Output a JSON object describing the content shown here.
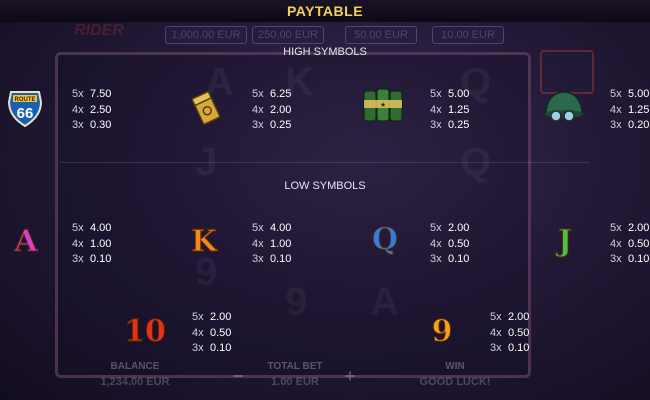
{
  "header": {
    "title": "PAYTABLE"
  },
  "sections": {
    "high_title": "HIGH SYMBOLS",
    "low_title": "LOW SYMBOLS"
  },
  "background": {
    "bets": [
      "1,000.00 EUR",
      "250.00 EUR",
      "50.00 EUR",
      "10.00 EUR"
    ],
    "logo": "RIDER",
    "balance_label": "BALANCE",
    "balance_value": "1,234.00 EUR",
    "bet_label": "TOTAL BET",
    "bet_value": "1.00 EUR",
    "win_label": "WIN",
    "win_value": "GOOD LUCK!",
    "minus": "−",
    "plus": "+"
  },
  "high_symbols": [
    {
      "icon": "route-66-sign-icon",
      "pays": [
        {
          "mult": "5x",
          "value": "7.50"
        },
        {
          "mult": "4x",
          "value": "2.50"
        },
        {
          "mult": "3x",
          "value": "0.30"
        }
      ]
    },
    {
      "icon": "lighter-icon",
      "pays": [
        {
          "mult": "5x",
          "value": "6.25"
        },
        {
          "mult": "4x",
          "value": "2.00"
        },
        {
          "mult": "3x",
          "value": "0.25"
        }
      ]
    },
    {
      "icon": "cans-icon",
      "pays": [
        {
          "mult": "5x",
          "value": "5.00"
        },
        {
          "mult": "4x",
          "value": "1.25"
        },
        {
          "mult": "3x",
          "value": "0.25"
        }
      ]
    },
    {
      "icon": "helmet-icon",
      "pays": [
        {
          "mult": "5x",
          "value": "5.00"
        },
        {
          "mult": "4x",
          "value": "1.25"
        },
        {
          "mult": "3x",
          "value": "0.20"
        }
      ]
    }
  ],
  "low_symbols": [
    {
      "label": "A",
      "color": "#d63fd0",
      "pays": [
        {
          "mult": "5x",
          "value": "4.00"
        },
        {
          "mult": "4x",
          "value": "1.00"
        },
        {
          "mult": "3x",
          "value": "0.10"
        }
      ]
    },
    {
      "label": "K",
      "color": "#f08a1e",
      "pays": [
        {
          "mult": "5x",
          "value": "4.00"
        },
        {
          "mult": "4x",
          "value": "1.00"
        },
        {
          "mult": "3x",
          "value": "0.10"
        }
      ]
    },
    {
      "label": "Q",
      "color": "#2f7fe0",
      "pays": [
        {
          "mult": "5x",
          "value": "2.00"
        },
        {
          "mult": "4x",
          "value": "0.50"
        },
        {
          "mult": "3x",
          "value": "0.10"
        }
      ]
    },
    {
      "label": "J",
      "color": "#49c24a",
      "pays": [
        {
          "mult": "5x",
          "value": "2.00"
        },
        {
          "mult": "4x",
          "value": "0.50"
        },
        {
          "mult": "3x",
          "value": "0.10"
        }
      ]
    },
    {
      "label": "10",
      "color": "#e8301f",
      "pays": [
        {
          "mult": "5x",
          "value": "2.00"
        },
        {
          "mult": "4x",
          "value": "0.50"
        },
        {
          "mult": "3x",
          "value": "0.10"
        }
      ]
    },
    {
      "label": "9",
      "color": "#f2a319",
      "pays": [
        {
          "mult": "5x",
          "value": "2.00"
        },
        {
          "mult": "4x",
          "value": "0.50"
        },
        {
          "mult": "3x",
          "value": "0.10"
        }
      ]
    }
  ]
}
